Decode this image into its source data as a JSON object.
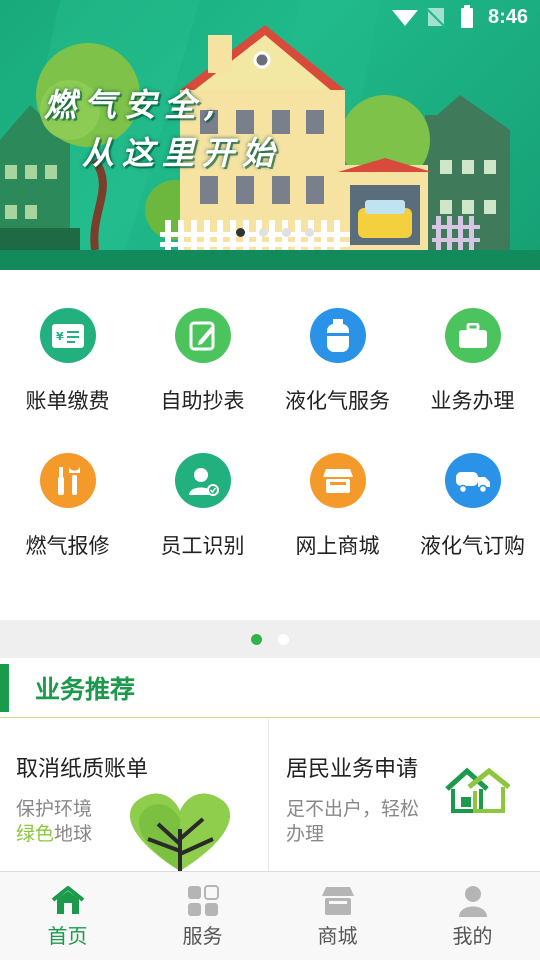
{
  "status_bar": {
    "time": "8:46"
  },
  "banner": {
    "slogan_line1": "燃气安全,",
    "slogan_line2": "从这里开始",
    "dots": 4,
    "active_dot": 0
  },
  "services": [
    {
      "label": "账单缴费",
      "icon": "bill-icon",
      "color": "#21b07e"
    },
    {
      "label": "自助抄表",
      "icon": "meter-note-icon",
      "color": "#4cc45e"
    },
    {
      "label": "液化气服务",
      "icon": "gas-cylinder-icon",
      "color": "#2a93e8"
    },
    {
      "label": "业务办理",
      "icon": "briefcase-icon",
      "color": "#4cc45e"
    },
    {
      "label": "燃气报修",
      "icon": "repair-tools-icon",
      "color": "#f49a2a"
    },
    {
      "label": "员工识别",
      "icon": "staff-id-icon",
      "color": "#21b07e"
    },
    {
      "label": "网上商城",
      "icon": "store-icon",
      "color": "#f49a2a"
    },
    {
      "label": "液化气订购",
      "icon": "delivery-truck-icon",
      "color": "#2a93e8"
    }
  ],
  "grid_pager": {
    "pages": 2,
    "active": 0
  },
  "section": {
    "title": "业务推荐"
  },
  "cards": [
    {
      "title": "取消纸质账单",
      "desc_part1": "保护环境",
      "desc_green": "绿色",
      "desc_part2": "地球",
      "image": "green-heart-tree"
    },
    {
      "title": "居民业务申请",
      "desc": "足不出户，轻松办理",
      "desc_line1": "足不出户，轻松",
      "desc_line2": "办理",
      "image": "houses-logo"
    }
  ],
  "bottom_nav": [
    {
      "label": "首页",
      "icon": "home-icon",
      "active": true
    },
    {
      "label": "服务",
      "icon": "services-grid-icon",
      "active": false
    },
    {
      "label": "商城",
      "icon": "shop-icon",
      "active": false
    },
    {
      "label": "我的",
      "icon": "user-icon",
      "active": false
    }
  ],
  "colors": {
    "brand_green": "#1a9a4a",
    "accent_light_green": "#8cc63f",
    "pager_active": "#34b24a"
  }
}
